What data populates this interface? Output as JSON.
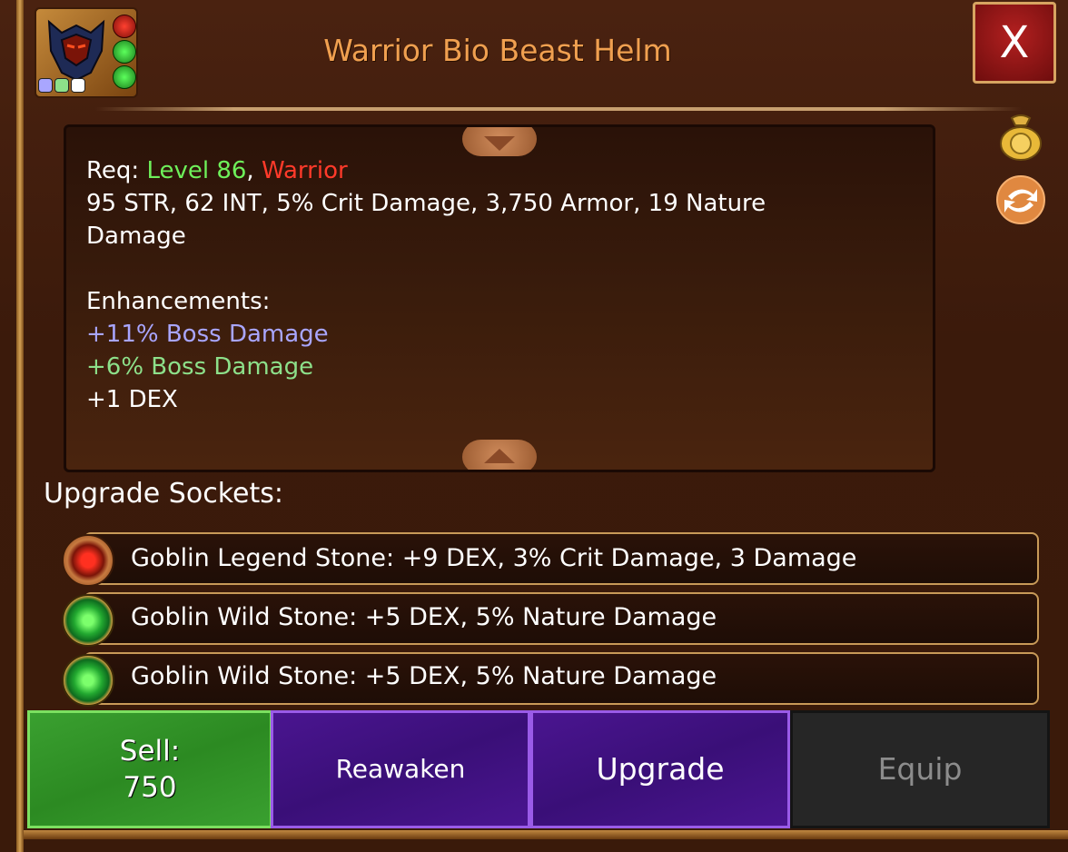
{
  "item": {
    "name": "Warrior Bio Beast Helm",
    "req_label": "Req:",
    "req_level": "Level 86",
    "req_sep": ",",
    "req_class": "Warrior",
    "stats_line1": "95 STR, 62 INT, 5% Crit Damage, 3,750 Armor, 19 Nature",
    "stats_line2": "Damage",
    "enhancements_label": "Enhancements:",
    "enhancements": [
      {
        "text": "+11% Boss Damage",
        "color": "#a9a6ff"
      },
      {
        "text": "+6% Boss Damage",
        "color": "#8de08a"
      },
      {
        "text": "+1 DEX",
        "color": "#ffffff"
      }
    ]
  },
  "close_label": "X",
  "sockets": {
    "title": "Upgrade Sockets:",
    "rows": [
      {
        "text": "Goblin Legend Stone: +9 DEX, 3% Crit Damage, 3 Damage",
        "gem": "red-gem-icon"
      },
      {
        "text": "Goblin Wild Stone: +5 DEX, 5% Nature Damage",
        "gem": "green-gem-icon"
      },
      {
        "text": "Goblin Wild Stone: +5 DEX, 5% Nature Damage",
        "gem": "green-gem-icon"
      }
    ]
  },
  "buttons": {
    "sell_label": "Sell:",
    "sell_value": "750",
    "reawaken": "Reawaken",
    "upgrade": "Upgrade",
    "equip": "Equip"
  },
  "colors": {
    "title": "#f0a050",
    "level": "#6ef05a",
    "class": "#ff3a2a"
  }
}
